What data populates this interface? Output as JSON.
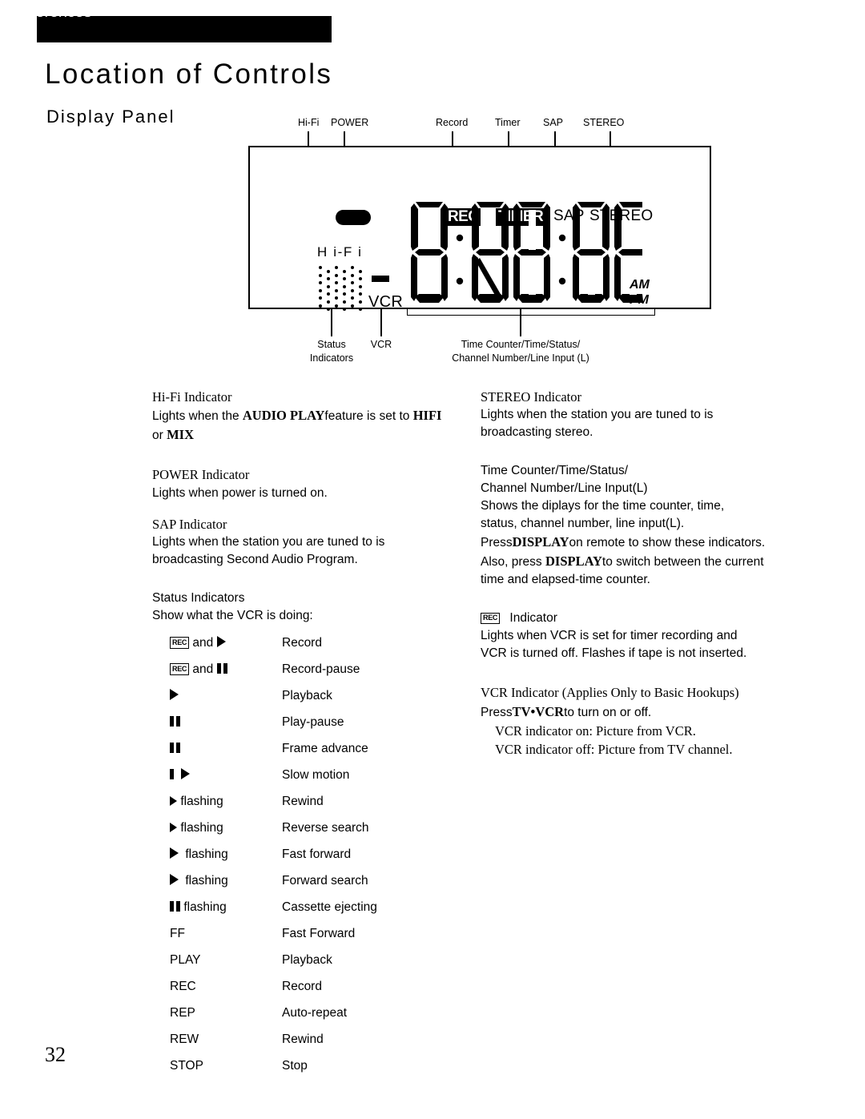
{
  "header": {
    "section_band": "References",
    "page_title": "Location of Controls",
    "sub_title": "Display Panel"
  },
  "diagram": {
    "callouts_top": [
      {
        "label": "Hi-Fi"
      },
      {
        "label": "POWER"
      },
      {
        "label": "Record"
      },
      {
        "label": "Timer"
      },
      {
        "label": "SAP"
      },
      {
        "label": "STEREO"
      }
    ],
    "callouts_bottom": [
      {
        "label": "Status\nIndicators"
      },
      {
        "label": "VCR"
      },
      {
        "label": "Time Counter/Time/Status/\nChannel Number/Line Input (L)"
      }
    ],
    "panel": {
      "badges": [
        {
          "name": "rec-badge",
          "label": "REC",
          "style": "inverted"
        },
        {
          "name": "timer-badge",
          "label": "TIMER",
          "style": "inverted"
        },
        {
          "name": "sap-badge",
          "label": "SAP",
          "style": "plain"
        },
        {
          "name": "stereo-badge",
          "label": "STEREO",
          "style": "plain"
        }
      ],
      "power_led": "power-led-icon",
      "hifi_lcd": "H i-F i",
      "vcr_lcd": "VCR",
      "minus_sign": "minus-sign-icon",
      "am_label": "AM",
      "pm_label": "PM",
      "segment_digits": "88:88",
      "dot_matrix": "dot-matrix-icon"
    }
  },
  "left_column": {
    "hifi": {
      "heading": "Hi-Fi Indicator",
      "body_1": "Lights when the ",
      "kw_1": "AUDIO PLAY",
      "body_2": "feature is set to ",
      "kw_2": "HIFI",
      "body_3": "or ",
      "kw_3": "MIX"
    },
    "power": {
      "heading": "POWER Indicator",
      "body": "Lights when power is turned on."
    },
    "sap": {
      "heading": "SAP Indicator",
      "body_line1": "Lights when the station you are tuned to is",
      "body_line2": "broadcasting Second Audio Program."
    },
    "status": {
      "heading": "Status Indicators",
      "sub": "Show what the VCR is doing:",
      "and_word": "and",
      "flashing_word": "flashing",
      "rows": [
        {
          "symbol": "rec-chip-and-play",
          "desc": "Record"
        },
        {
          "symbol": "rec-chip-and-pause",
          "desc": "Record-pause"
        },
        {
          "symbol": "play",
          "desc": "Playback"
        },
        {
          "symbol": "pause",
          "desc": "Play-pause"
        },
        {
          "symbol": "pause",
          "desc": "Frame advance"
        },
        {
          "symbol": "bar-play",
          "desc": "Slow motion"
        },
        {
          "symbol": "play-flashing",
          "desc": "Rewind"
        },
        {
          "symbol": "play-flashing",
          "desc": "Reverse search"
        },
        {
          "symbol": "play-flashing-lg",
          "desc": "Fast forward"
        },
        {
          "symbol": "play-flashing-lg",
          "desc": "Forward search"
        },
        {
          "symbol": "pause-flashing",
          "desc": "Cassette ejecting"
        },
        {
          "symbol": "FF",
          "desc": "Fast Forward"
        },
        {
          "symbol": "PLAY",
          "desc": "Playback"
        },
        {
          "symbol": "REC",
          "desc": "Record"
        },
        {
          "symbol": "REP",
          "desc": "Auto-repeat"
        },
        {
          "symbol": "REW",
          "desc": "Rewind"
        },
        {
          "symbol": "STOP",
          "desc": "Stop"
        }
      ]
    }
  },
  "right_column": {
    "stereo": {
      "heading": "STEREO Indicator",
      "body_line1": "Lights when the station you are tuned to is",
      "body_line2": "broadcasting stereo."
    },
    "time_counter": {
      "heading_line1": "Time Counter/Time/Status/",
      "heading_line2": "Channel Number/Line Input(L)",
      "body_line1": "Shows the diplays for the time counter, time,",
      "body_line2": "status, channel number, line input(L).",
      "press_word": "Press",
      "kw_display": "DISPLAY",
      "body_line3": "on remote to show these indicators.",
      "body_line4_a": "Also, press ",
      "body_line4_b": "to switch between the current",
      "body_line5": "time and elapsed-time counter."
    },
    "rec": {
      "heading_chip": "REC",
      "heading_word": "Indicator",
      "body_line1": "Lights when VCR is set for timer recording and",
      "body_line2": "VCR is turned off.  Flashes if tape is not inserted."
    },
    "vcr": {
      "heading": "VCR Indicator (Applies   Only to Basic Hookups)",
      "press_word": "Press",
      "kw_tvvcr": "TV•VCR",
      "press_tail": "to turn on or off.",
      "on_line": "VCR indicator on:  Picture from VCR.",
      "off_line": "VCR indicator off:  Picture  from TV channel."
    }
  },
  "footer": {
    "page_number": "32"
  }
}
